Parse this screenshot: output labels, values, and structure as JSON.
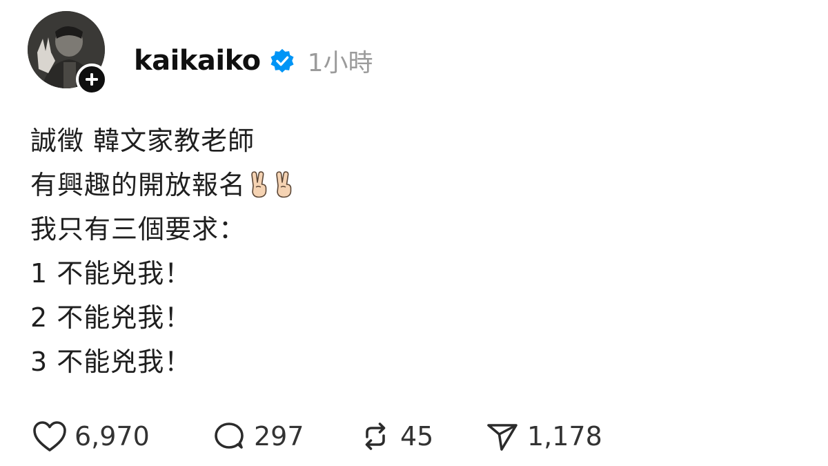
{
  "post": {
    "author": {
      "username": "kaikaiko",
      "verified": true,
      "avatar_icon": "profile-photo",
      "follow_icon": "plus-icon"
    },
    "timestamp": "1小時",
    "lines": [
      "誠徵 韓文家教老師",
      "有興趣的開放報名",
      "我只有三個要求：",
      "1 不能兇我！",
      "2 不能兇我！",
      "3 不能兇我！"
    ],
    "emoji_after_line_2": [
      "victory-hand",
      "victory-hand"
    ],
    "actions": {
      "like": {
        "icon": "heart-icon",
        "count": "6,970"
      },
      "reply": {
        "icon": "comment-icon",
        "count": "297"
      },
      "repost": {
        "icon": "repost-icon",
        "count": "45"
      },
      "share": {
        "icon": "send-icon",
        "count": "1,178"
      }
    },
    "colors": {
      "verified_blue": "#0095f6",
      "timestamp_gray": "#9b9b9b",
      "text": "#1f1f1f"
    }
  }
}
